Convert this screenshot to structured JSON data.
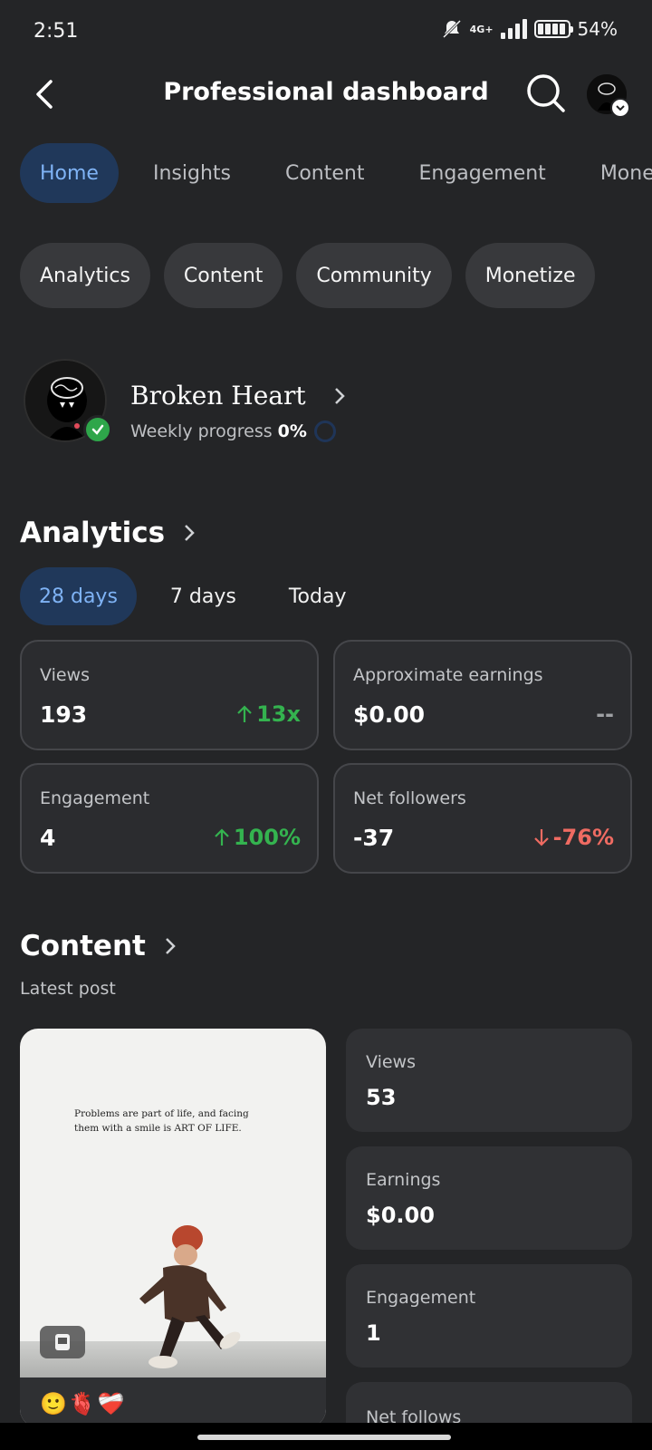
{
  "status_bar": {
    "time": "2:51",
    "network": "4G+",
    "battery": "54%"
  },
  "header": {
    "title": "Professional dashboard",
    "back_icon": "back-arrow-icon",
    "search_icon": "search-icon"
  },
  "tabs": [
    {
      "label": "Home",
      "active": true
    },
    {
      "label": "Insights",
      "active": false
    },
    {
      "label": "Content",
      "active": false
    },
    {
      "label": "Engagement",
      "active": false
    },
    {
      "label": "Monet",
      "active": false
    }
  ],
  "chips": [
    {
      "label": "Analytics"
    },
    {
      "label": "Content"
    },
    {
      "label": "Community"
    },
    {
      "label": "Monetize"
    }
  ],
  "profile": {
    "name": "Broken Heart",
    "progress_label": "Weekly progress",
    "progress_value": "0%"
  },
  "analytics": {
    "title": "Analytics",
    "ranges": [
      {
        "label": "28 days",
        "active": true
      },
      {
        "label": "7 days",
        "active": false
      },
      {
        "label": "Today",
        "active": false
      }
    ],
    "metrics": [
      {
        "label": "Views",
        "value": "193",
        "change": "13x",
        "trend": "up"
      },
      {
        "label": "Approximate earnings",
        "value": "$0.00",
        "change": "--",
        "trend": "neutral"
      },
      {
        "label": "Engagement",
        "value": "4",
        "change": "100%",
        "trend": "up"
      },
      {
        "label": "Net followers",
        "value": "-37",
        "change": "-76%",
        "trend": "down"
      }
    ]
  },
  "content": {
    "title": "Content",
    "latest_label": "Latest post",
    "post_text": "Problems are part of life, and facing them with a smile is ART OF LIFE.",
    "post_emojis": "🙂🫀❤️‍🩹",
    "stats": [
      {
        "label": "Views",
        "value": "53"
      },
      {
        "label": "Earnings",
        "value": "$0.00"
      },
      {
        "label": "Engagement",
        "value": "1"
      },
      {
        "label": "Net follows",
        "value": ""
      }
    ]
  },
  "colors": {
    "background": "#242527",
    "accent_bg": "#20385a",
    "accent_text": "#7fb3f5",
    "up": "#34b34f",
    "down": "#ef6b62"
  }
}
